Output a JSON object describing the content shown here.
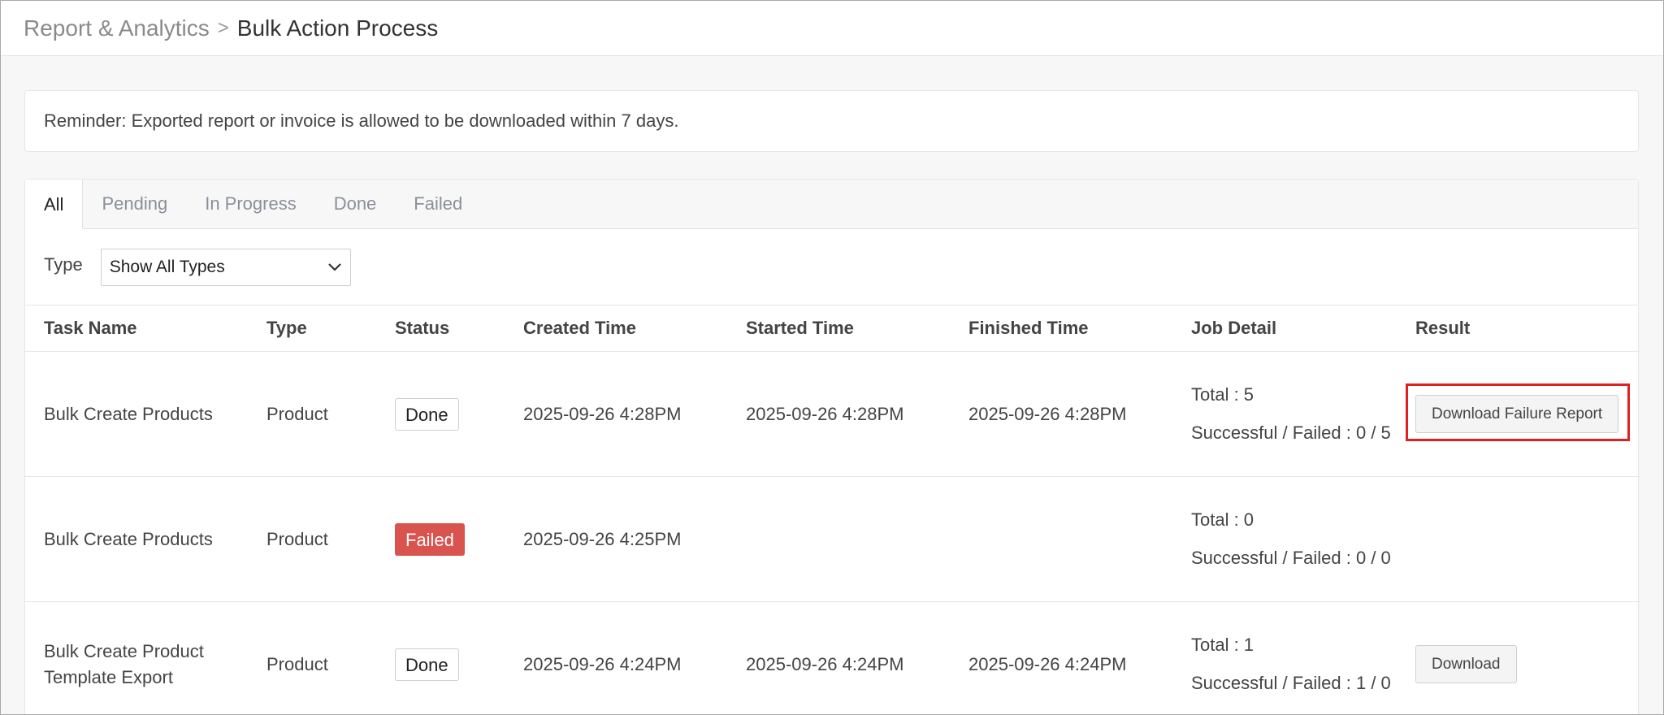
{
  "breadcrumb": {
    "parent": "Report & Analytics",
    "separator": ">",
    "current": "Bulk Action Process"
  },
  "reminder": "Reminder: Exported report or invoice is allowed to be downloaded within 7 days.",
  "tabs": [
    {
      "label": "All",
      "active": true
    },
    {
      "label": "Pending",
      "active": false
    },
    {
      "label": "In Progress",
      "active": false
    },
    {
      "label": "Done",
      "active": false
    },
    {
      "label": "Failed",
      "active": false
    }
  ],
  "filter": {
    "label": "Type",
    "selected": "Show All Types"
  },
  "table": {
    "columns": [
      "Task Name",
      "Type",
      "Status",
      "Created Time",
      "Started Time",
      "Finished Time",
      "Job Detail",
      "Result"
    ],
    "rows": [
      {
        "task_name": "Bulk Create Products",
        "type": "Product",
        "status": "Done",
        "created": "2025-09-26 4:28PM",
        "started": "2025-09-26 4:28PM",
        "finished": "2025-09-26 4:28PM",
        "detail_total": "Total : 5",
        "detail_result": "Successful / Failed : 0 / 5",
        "result_button": "Download Failure Report"
      },
      {
        "task_name": "Bulk Create Products",
        "type": "Product",
        "status": "Failed",
        "created": "2025-09-26 4:25PM",
        "started": "",
        "finished": "",
        "detail_total": "Total : 0",
        "detail_result": "Successful / Failed : 0 / 0",
        "result_button": ""
      },
      {
        "task_name": "Bulk Create Product Template Export",
        "type": "Product",
        "status": "Done",
        "created": "2025-09-26 4:24PM",
        "started": "2025-09-26 4:24PM",
        "finished": "2025-09-26 4:24PM",
        "detail_total": "Total : 1",
        "detail_result": "Successful / Failed : 1 / 0",
        "result_button": "Download"
      }
    ]
  },
  "icons": {
    "breadcrumb_separator": "chevron-right-icon",
    "select_toggle": "chevron-down-icon"
  },
  "colors": {
    "failed_badge": "#d9534f",
    "highlight": "#e02020"
  }
}
